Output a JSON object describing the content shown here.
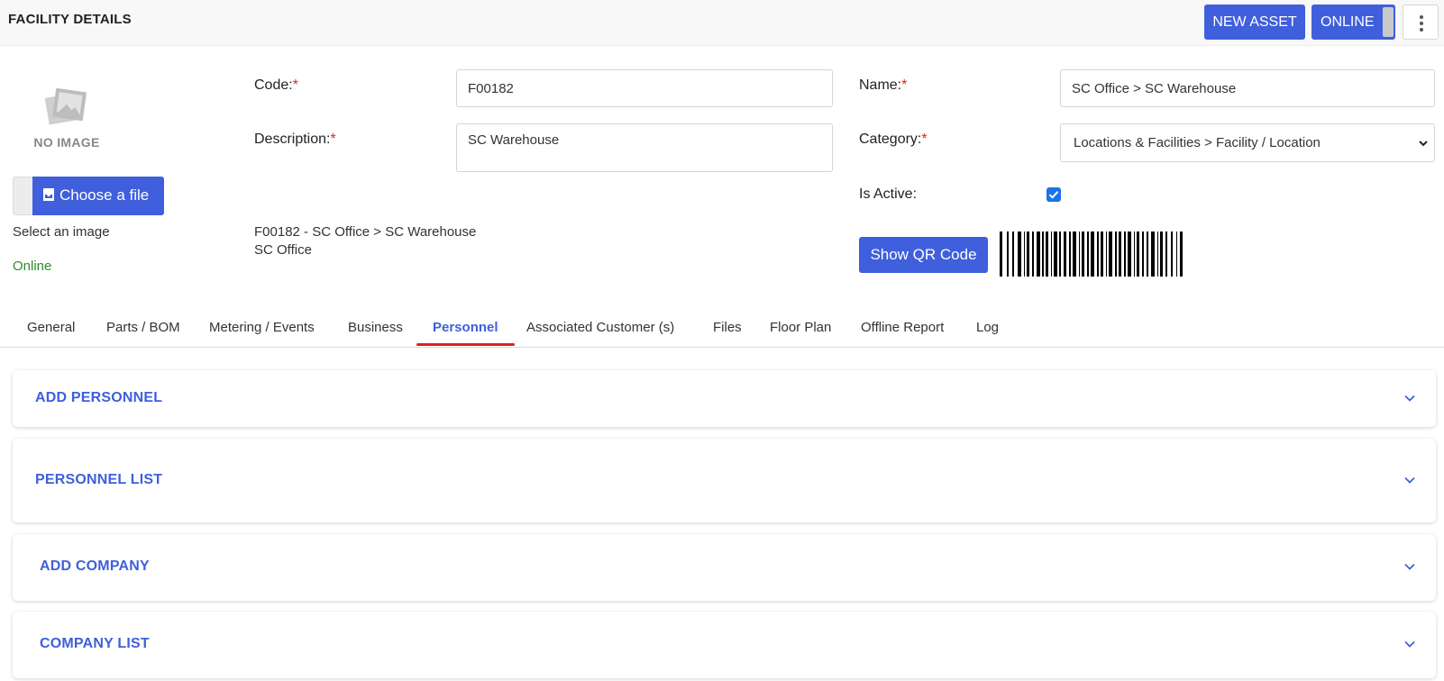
{
  "header": {
    "title": "FACILITY DETAILS",
    "new_asset_label": "NEW ASSET",
    "online_label": "ONLINE"
  },
  "image_panel": {
    "no_image_text": "NO IMAGE",
    "choose_file_label": "Choose a file",
    "select_image_text": "Select an image",
    "status_text": "Online"
  },
  "form": {
    "code_label": "Code:",
    "code_value": "F00182",
    "description_label": "Description:",
    "description_value": "SC Warehouse",
    "name_label": "Name:",
    "name_value": "SC Office > SC Warehouse",
    "category_label": "Category:",
    "category_value": "Locations & Facilities > Facility / Location",
    "is_active_label": "Is Active:",
    "is_active": true,
    "required_mark": "*"
  },
  "summary": {
    "line1": "F00182 - SC Office > SC Warehouse",
    "line2": "SC Office"
  },
  "qr": {
    "button_label": "Show QR Code"
  },
  "tabs": [
    {
      "label": "General"
    },
    {
      "label": "Parts / BOM"
    },
    {
      "label": "Metering / Events"
    },
    {
      "label": "Business"
    },
    {
      "label": "Personnel",
      "active": true
    },
    {
      "label": "Associated Customer (s)"
    },
    {
      "label": "Files"
    },
    {
      "label": "Floor Plan"
    },
    {
      "label": "Offline Report"
    },
    {
      "label": "Log"
    }
  ],
  "panels": [
    {
      "title": "ADD PERSONNEL"
    },
    {
      "title": "PERSONNEL LIST"
    },
    {
      "title": "ADD COMPANY"
    },
    {
      "title": "COMPANY LIST"
    }
  ],
  "colors": {
    "primary": "#3f5fdc",
    "required": "#e02020",
    "online": "#2e8b2e",
    "tab_underline": "#e02020",
    "checkbox": "#1a73e8"
  },
  "icons": {
    "image_placeholder": "image-placeholder-icon",
    "upload": "inbox-upload-icon",
    "more": "more-vertical-icon",
    "chevron": "chevron-down-icon",
    "select_caret": "caret-down-icon"
  }
}
